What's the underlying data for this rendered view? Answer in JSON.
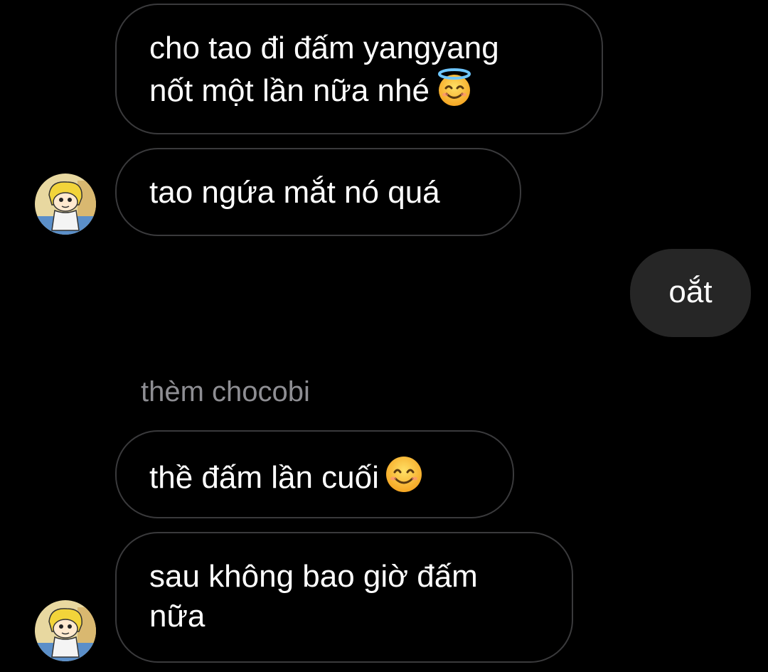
{
  "conversation": {
    "messages": [
      {
        "direction": "received",
        "text": "cho tao đi đấm yangyang\nnốt một lần nữa nhé",
        "emoji": "smiling-face-with-halo-icon"
      },
      {
        "direction": "received",
        "text": "tao ngứa mắt nó quá"
      },
      {
        "direction": "sent",
        "text": "oắt"
      },
      {
        "direction": "received",
        "text": "thề đấm lần cuối",
        "emoji": "smiling-face-icon"
      },
      {
        "direction": "received",
        "text": "sau không bao giờ đấm\nnữa"
      }
    ],
    "sender_label": "thèm chocobi"
  },
  "colors": {
    "background": "#000000",
    "received_bubble_border": "#3a3a3c",
    "sent_bubble_fill": "#262626",
    "label_text": "#8e8e93"
  },
  "icons": {
    "avatar": "cartoon-avatar-icon"
  }
}
